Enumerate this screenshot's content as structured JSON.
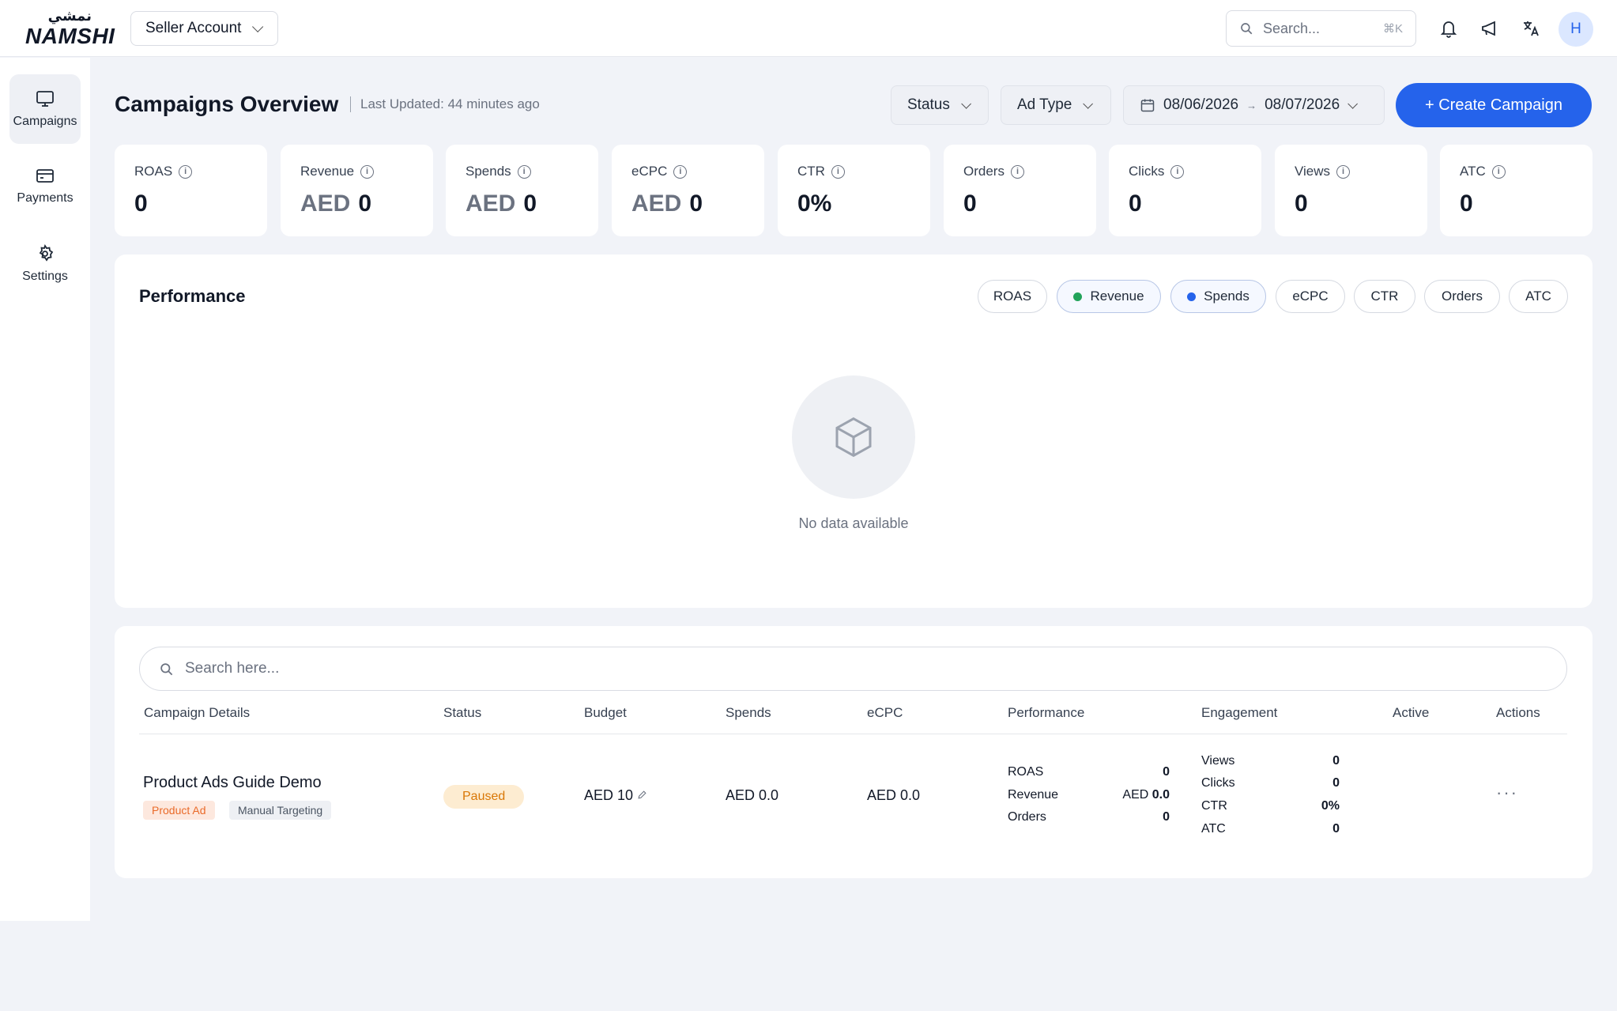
{
  "brand": {
    "arabic": "نمشي",
    "name": "NAMSHI"
  },
  "account_selector": {
    "label": "Seller Account"
  },
  "top_search": {
    "placeholder": "Search...",
    "shortcut": "⌘K"
  },
  "user": {
    "avatar_initial": "H"
  },
  "sidebar": {
    "items": [
      {
        "label": "Campaigns",
        "icon": "monitor-icon",
        "active": true
      },
      {
        "label": "Payments",
        "icon": "credit-card-icon"
      },
      {
        "label": "Settings",
        "icon": "gear-icon"
      }
    ]
  },
  "header": {
    "title": "Campaigns Overview",
    "last_updated": "Last Updated: 44 minutes ago"
  },
  "filters": {
    "status": "Status",
    "ad_type": "Ad Type",
    "date_from": "08/06/2026",
    "date_arrow": "→",
    "date_to": "08/07/2026"
  },
  "create_button": "+ Create Campaign",
  "kpis": [
    {
      "label": "ROAS",
      "currency": "",
      "value": "0"
    },
    {
      "label": "Revenue",
      "currency": "AED",
      "value": "0"
    },
    {
      "label": "Spends",
      "currency": "AED",
      "value": "0"
    },
    {
      "label": "eCPC",
      "currency": "AED",
      "value": "0"
    },
    {
      "label": "CTR",
      "currency": "",
      "value": "0%"
    },
    {
      "label": "Orders",
      "currency": "",
      "value": "0"
    },
    {
      "label": "Clicks",
      "currency": "",
      "value": "0"
    },
    {
      "label": "Views",
      "currency": "",
      "value": "0"
    },
    {
      "label": "ATC",
      "currency": "",
      "value": "0"
    }
  ],
  "performance": {
    "title": "Performance",
    "metrics": [
      "ROAS",
      "Revenue",
      "Spends",
      "eCPC",
      "CTR",
      "Orders",
      "ATC"
    ],
    "colors": {
      "revenue": "#22a35a",
      "spends": "#2563eb"
    },
    "empty_text": "No data available"
  },
  "table": {
    "search_placeholder": "Search here...",
    "columns": [
      "Campaign Details",
      "Status",
      "Budget",
      "Spends",
      "eCPC",
      "Performance",
      "Engagement",
      "Active",
      "Actions"
    ],
    "rows": [
      {
        "name": "Product Ads Guide Demo",
        "tags": [
          "Product Ad",
          "Manual Targeting"
        ],
        "status": "Paused",
        "budget": "AED 10",
        "spends": "AED 0.0",
        "ecpc": "AED 0.0",
        "performance": [
          {
            "label": "ROAS",
            "value": "0"
          },
          {
            "label": "Revenue",
            "currency": "AED",
            "value": "0.0"
          },
          {
            "label": "Orders",
            "value": "0"
          }
        ],
        "engagement": [
          {
            "label": "Views",
            "value": "0"
          },
          {
            "label": "Clicks",
            "value": "0"
          },
          {
            "label": "CTR",
            "value": "0%"
          },
          {
            "label": "ATC",
            "value": "0"
          }
        ],
        "actions": "···"
      }
    ]
  }
}
